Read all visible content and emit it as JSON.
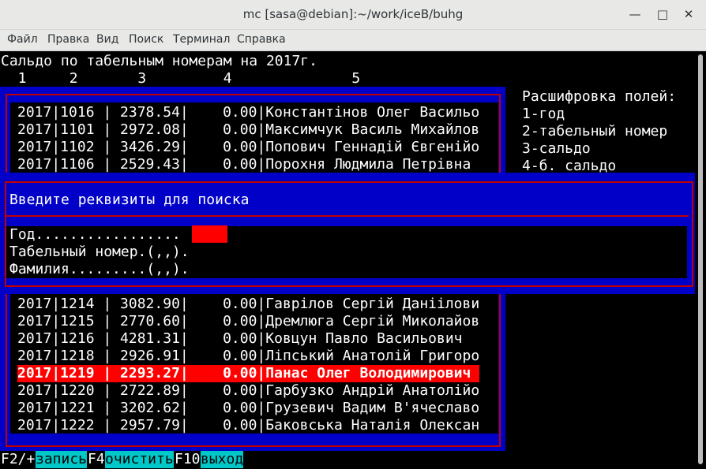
{
  "window": {
    "title": "mc [sasa@debian]:~/work/iceB/buhg",
    "minimize_icon": "minimize-icon",
    "maximize_icon": "maximize-icon",
    "close_icon": "close-icon"
  },
  "menu": [
    {
      "label": "Файл"
    },
    {
      "label": "Правка"
    },
    {
      "label": "Вид"
    },
    {
      "label": "Поиск"
    },
    {
      "label": "Терминал"
    },
    {
      "label": "Справка"
    }
  ],
  "header": {
    "title": "Сальдо по табельным номерам на 2017г.",
    "column_numbers": "  1     2       3         4              5"
  },
  "legend": {
    "title": "Расшифровка полей:",
    "items": [
      "1-год",
      "2-табельный номер",
      "3-сальдо",
      "4-б. сальдо"
    ]
  },
  "rows_top": [
    "2017|1016 | 2378.54|    0.00|Константінов Олег Васильо",
    "2017|1101 | 2972.08|    0.00|Максимчук Василь Михайлов",
    "2017|1102 | 3426.29|    0.00|Попович Геннадій Євгенійо",
    "2017|1106 | 2529.43|    0.00|Порохня Людмила Петрівна "
  ],
  "rows_bottom": [
    "2017|1214 | 3082.90|    0.00|Гаврілов Сергій Даніілови",
    "2017|1215 | 2770.60|    0.00|Дремлюга Сергій Миколайов",
    "2017|1216 | 4281.31|    0.00|Ковцун Павло Васильович  ",
    "2017|1218 | 2926.91|    0.00|Ліпський Анатолій Григоро",
    "2017|1219 | 2293.27|    0.00|Панас Олег Володимирович ",
    "2017|1220 | 2722.89|    0.00|Гарбузко Андрій Анатолійо",
    "2017|1221 | 3202.62|    0.00|Грузевич Вадим В'ячеславо",
    "2017|1222 | 2957.79|    0.00|Баковська Наталія Олексан"
  ],
  "selected_row_index": 4,
  "dialog": {
    "title": "Введите реквизиты для поиска",
    "fields": [
      {
        "label": "Год.................",
        "value": ""
      },
      {
        "label": "Табельный номер.(,,).",
        "value": ""
      },
      {
        "label": "Фамилия.........(,,).",
        "value": ""
      }
    ]
  },
  "footer": {
    "keys": [
      {
        "key": "F2/+",
        "label": "запись"
      },
      {
        "key": "F4",
        "label": "очистить"
      },
      {
        "key": "F10",
        "label": "выход"
      }
    ]
  },
  "colors": {
    "blue": "#0000c8",
    "red_frame": "#c00000",
    "selection": "#ff0000",
    "cyan": "#00c8c8"
  }
}
